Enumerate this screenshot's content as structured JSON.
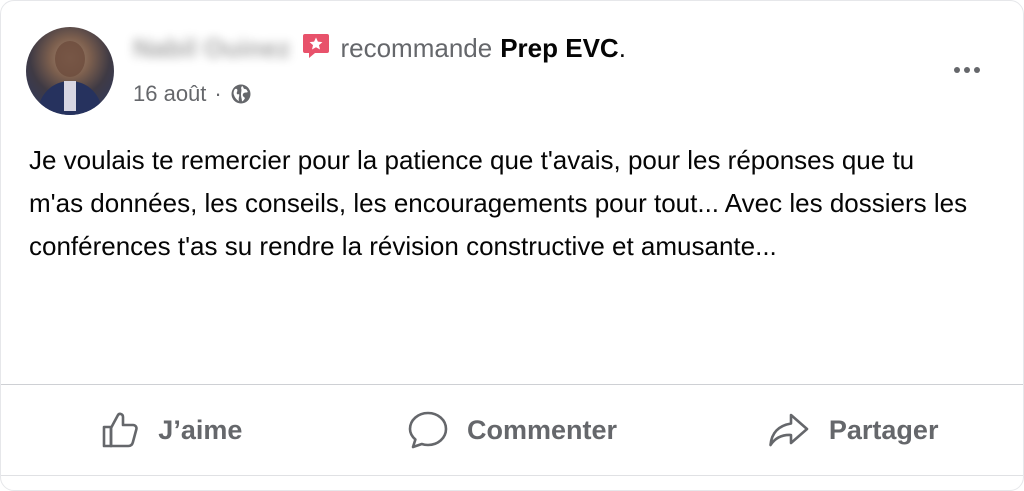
{
  "post": {
    "author": "Nabil Ouinez",
    "recommend_text": "recommande",
    "page_name": "Prep EVC",
    "period": ".",
    "date": "16 août",
    "separator": "·",
    "body": "Je voulais te remercier pour la patience que t'avais, pour les réponses que tu m'as données, les conseils, les encouragements pour tout... Avec les dossiers les conférences t'as su rendre la révision constructive et amusante..."
  },
  "actions": {
    "like_label": "J’aime",
    "comment_label": "Commenter",
    "share_label": "Partager"
  },
  "icons": {
    "recommend": "recommend-star-icon",
    "privacy": "globe-icon",
    "more": "more-options-icon",
    "like": "thumbs-up-icon",
    "comment": "comment-bubble-icon",
    "share": "share-arrow-icon"
  },
  "colors": {
    "recommend_accent": "#e8526b",
    "secondary_text": "#65676b",
    "primary_text": "#050505"
  }
}
